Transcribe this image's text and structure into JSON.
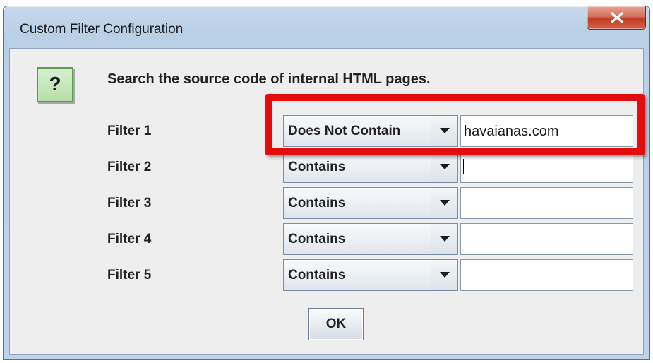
{
  "window": {
    "title": "Custom Filter Configuration"
  },
  "dialog": {
    "icon": "question-icon",
    "icon_glyph": "?",
    "message": "Search the source code of internal HTML pages.",
    "ok_label": "OK"
  },
  "filters": [
    {
      "label": "Filter 1",
      "operator": "Does Not Contain",
      "value": "havaianas.com"
    },
    {
      "label": "Filter 2",
      "operator": "Contains",
      "value": ""
    },
    {
      "label": "Filter 3",
      "operator": "Contains",
      "value": ""
    },
    {
      "label": "Filter 4",
      "operator": "Contains",
      "value": ""
    },
    {
      "label": "Filter 5",
      "operator": "Contains",
      "value": ""
    }
  ],
  "colors": {
    "highlight": "#e30d0d",
    "icon_background": "#b6e0a8",
    "close_button": "#c23d24"
  }
}
